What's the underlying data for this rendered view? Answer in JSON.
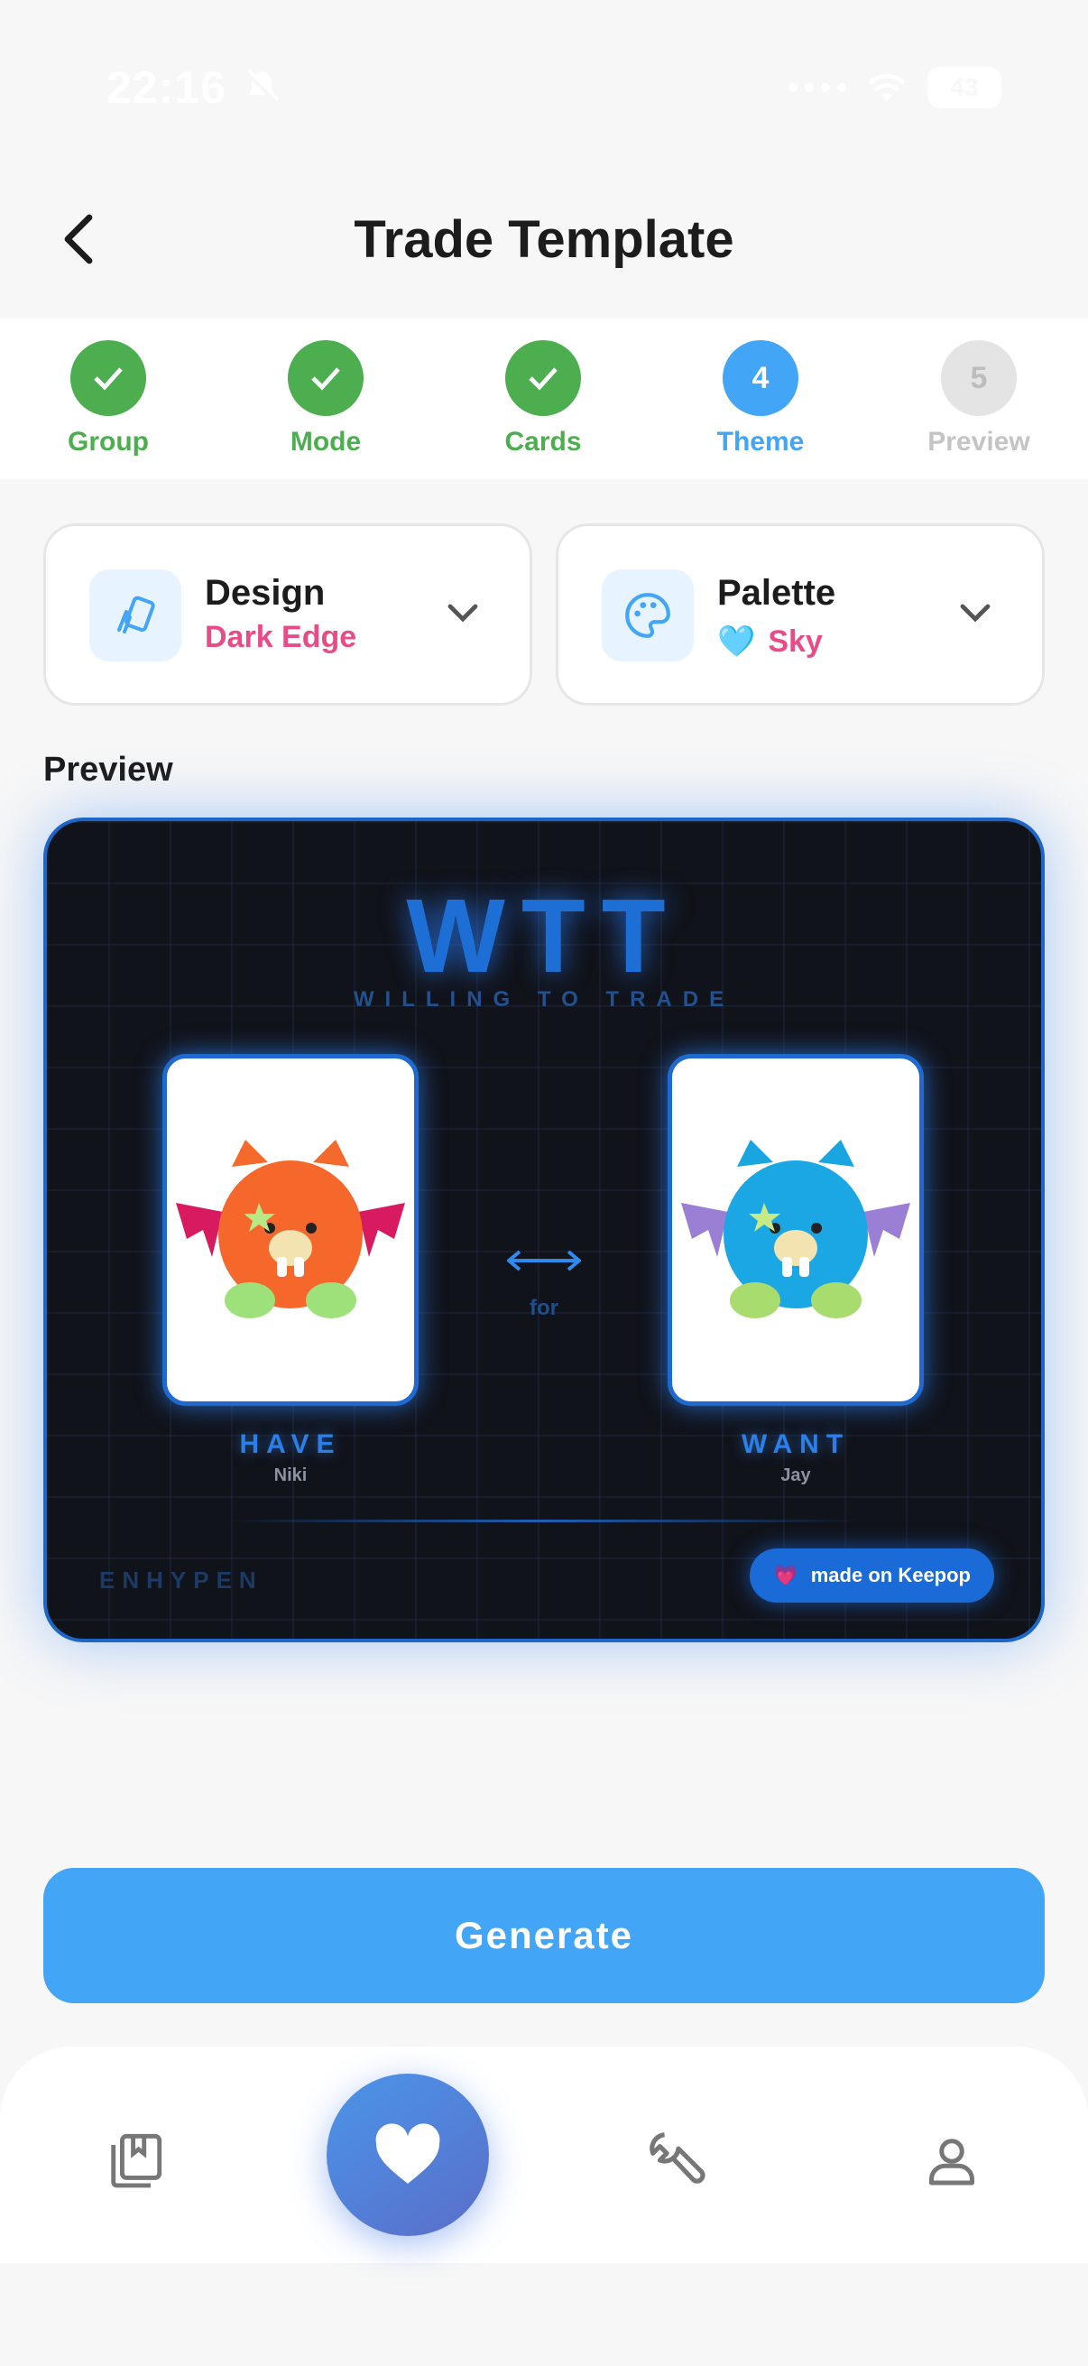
{
  "status_bar": {
    "time": "22:16",
    "battery": "43"
  },
  "header": {
    "title": "Trade Template"
  },
  "stepper": {
    "steps": [
      {
        "label": "Group",
        "state": "done",
        "number": "1"
      },
      {
        "label": "Mode",
        "state": "done",
        "number": "2"
      },
      {
        "label": "Cards",
        "state": "done",
        "number": "3"
      },
      {
        "label": "Theme",
        "state": "active",
        "number": "4"
      },
      {
        "label": "Preview",
        "state": "todo",
        "number": "5"
      }
    ]
  },
  "design_selector": {
    "title": "Design",
    "value": "Dark Edge",
    "icon": "cards-icon"
  },
  "palette_selector": {
    "title": "Palette",
    "value": "Sky",
    "emoji": "🩵",
    "icon": "palette-icon"
  },
  "preview": {
    "section_label": "Preview",
    "title": "WTT",
    "subtitle": "WILLING TO TRADE",
    "have": {
      "role": "HAVE",
      "member": "Niki"
    },
    "want": {
      "role": "WANT",
      "member": "Jay"
    },
    "swap_label": "for",
    "group": "ENHYPEN",
    "badge": {
      "emoji": "💗",
      "text": "made on Keepop"
    }
  },
  "generate_button": {
    "label": "Generate"
  },
  "colors": {
    "done": "#4cae4f",
    "active": "#42a5f5",
    "accent_pink": "#e84c88",
    "card_border": "#1c66c9"
  },
  "bottom_nav": {
    "items": [
      "collection-icon",
      "heart-icon",
      "wrench-icon",
      "profile-icon"
    ]
  }
}
